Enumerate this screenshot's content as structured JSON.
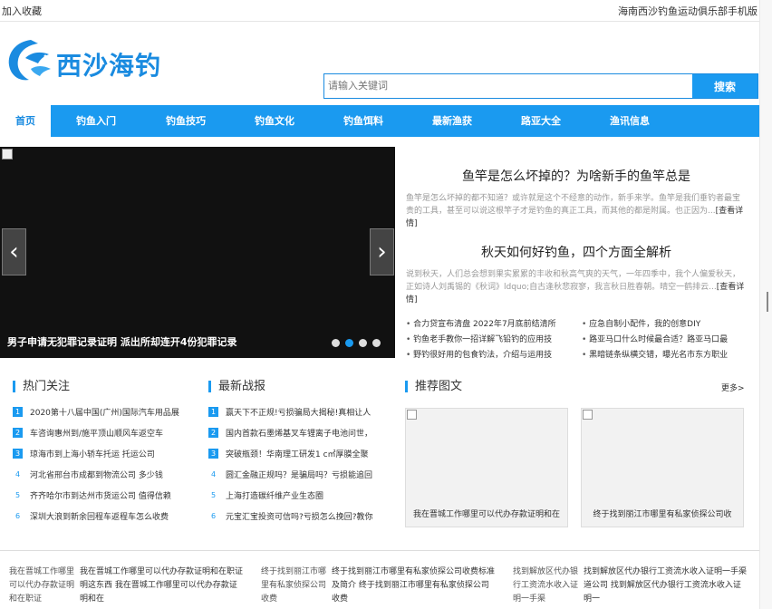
{
  "topbar": {
    "left": "加入收藏",
    "right": "海南西沙钓鱼运动俱乐部手机版"
  },
  "logo": {
    "text": "西沙海钓"
  },
  "search": {
    "placeholder": "请输入关键词",
    "button": "搜索"
  },
  "nav": [
    "首页",
    "钓鱼入门",
    "钓鱼技巧",
    "钓鱼文化",
    "钓鱼饵料",
    "最新渔获",
    "路亚大全",
    "渔讯信息"
  ],
  "slider": {
    "caption": "男子申请无犯罪记录证明 派出所却连开4份犯罪记录",
    "arrow_left": "‹",
    "arrow_right": "›"
  },
  "headlines": [
    {
      "title": "鱼竿是怎么坏掉的？为啥新手的鱼竿总是",
      "desc": "鱼竿是怎么坏掉的都不知道？或许就是这个不经意的动作，新手来学。鱼竿是我们垂钓者最宝贵的工具，甚至可以说这根竿子才是钓鱼的真正工具，而其他的都是附属。也正因为...",
      "more": "[查看详情]"
    },
    {
      "title": "秋天如何好钓鱼，四个方面全解析",
      "desc": "说到秋天，人们总会想到果实累累的丰收和秋高气爽的天气，一年四季中，我个人偏爱秋天，正如诗人刘禹锡的《秋词》ldquo;自古逢秋悲寂寥，我言秋日胜春朝。晴空一鹤排云...",
      "more": "[查看详情]"
    }
  ],
  "headline_list": [
    "合力贷宣布清盘 2022年7月底前结清所",
    "应急自制小配件，我的创意DIY",
    "钓鱼老手教你一招详解飞铅钓的应用技",
    "路亚马口什么时候最合适？路亚马口最",
    "野钓很好用的包食钓法，介绍与运用技",
    "黑暗链条纵横交错，曝光名市东方职业"
  ],
  "hot": {
    "title": "热门关注",
    "items": [
      "2020第十八届中国(广州)国际汽车用品展",
      "车咨询惠州到/施平顶山顺风车返空车",
      "琼海市到上海小轿车托运 托运公司",
      "河北省邢台市成都到物流公司 多少钱",
      "齐齐哈尔市到达州市货运公司 值得信赖",
      "深圳大浪到新余回程车返程车怎么收费"
    ]
  },
  "news": {
    "title": "最新战报",
    "items": [
      "赢天下不正规!亏损骗局大揭秘!真相让人",
      "国内首款石墨烯基叉车锂离子电池问世，",
      "突破瓶颈！华南理工研发1 c㎡厚膜全聚",
      "圆汇金融正规吗？是骗局吗？亏损能追回",
      "上海打造碳纤维产业生态圈",
      "元宝汇宝投资可信吗?亏损怎么挽回?教你"
    ]
  },
  "pics": {
    "title": "推荐图文",
    "more": "更多>",
    "cards": [
      "我在晋城工作哪里可以代办存款证明和在",
      "终于找到丽江市哪里有私家侦探公司收"
    ]
  },
  "bottom": [
    {
      "alt": "我在晋城工作哪里可以代办存款证明和在职证",
      "text": "我在晋城工作哪里可以代办存款证明和在职证明这东西 我在晋城工作哪里可以代办存款证明和在"
    },
    {
      "alt": "终于找到丽江市哪里有私家侦探公司收费",
      "text": "终于找到丽江市哪里有私家侦探公司收费标准及简介 终于找到丽江市哪里有私家侦探公司收费"
    },
    {
      "alt": "找到解放区代办银行工资流水收入证明一手渠",
      "text": "找到解放区代办银行工资流水收入证明一手渠道公司 找到解放区代办银行工资流水收入证明一"
    }
  ],
  "colors": {
    "accent": "#1a9af0",
    "dark": "#111111"
  }
}
